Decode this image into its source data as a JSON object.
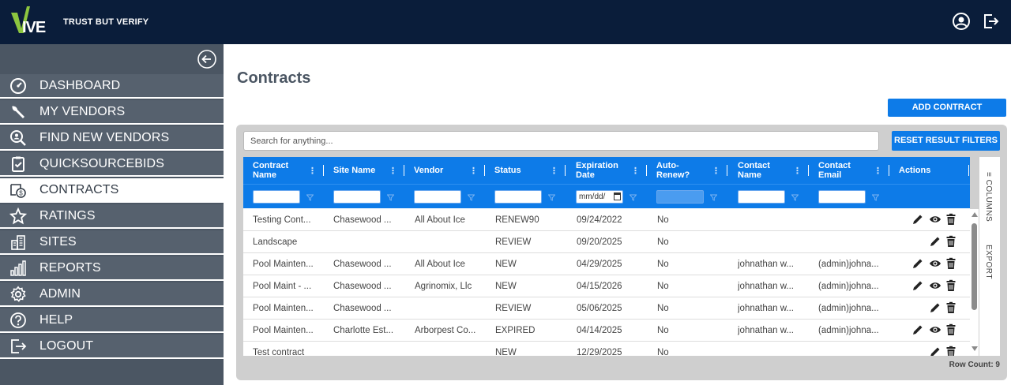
{
  "app": {
    "logo_text": "VIVE",
    "tagline": "TRUST BUT VERIFY",
    "colors": {
      "topbar": "#0a1d3a",
      "sidebar": "#4b5663",
      "accent": "#0d7be8",
      "logo_green": "#8cc63f"
    }
  },
  "header_icons": [
    {
      "name": "account-icon"
    },
    {
      "name": "logout-icon"
    }
  ],
  "sidebar": {
    "collapse_icon": "arrow-left-circle-icon",
    "items": [
      {
        "label": "DASHBOARD",
        "icon": "speedometer-icon",
        "active": false
      },
      {
        "label": "MY VENDORS",
        "icon": "wrench-icon",
        "active": false
      },
      {
        "label": "FIND NEW VENDORS",
        "icon": "search-person-icon",
        "active": false
      },
      {
        "label": "QUICKSOURCEBIDS",
        "icon": "clipboard-check-icon",
        "active": false
      },
      {
        "label": "CONTRACTS",
        "icon": "contract-money-icon",
        "active": true
      },
      {
        "label": "RATINGS",
        "icon": "star-icon",
        "active": false
      },
      {
        "label": "SITES",
        "icon": "building-icon",
        "active": false
      },
      {
        "label": "REPORTS",
        "icon": "bar-chart-icon",
        "active": false
      },
      {
        "label": "ADMIN",
        "icon": "gear-icon",
        "active": false
      },
      {
        "label": "HELP",
        "icon": "help-circle-icon",
        "active": false
      },
      {
        "label": "LOGOUT",
        "icon": "logout-icon",
        "active": false
      }
    ]
  },
  "main": {
    "title": "Contracts",
    "add_button": "ADD CONTRACT",
    "search_placeholder": "Search for anything...",
    "reset_button": "RESET RESULT FILTERS",
    "side_tabs": {
      "columns": "COLUMNS",
      "export": "EXPORT"
    },
    "row_count": "Row Count: 9",
    "date_filter_placeholder": "mm/dd/"
  },
  "table": {
    "columns": [
      {
        "label": "Contract Name",
        "filter": "text"
      },
      {
        "label": "Site Name",
        "filter": "text"
      },
      {
        "label": "Vendor",
        "filter": "text"
      },
      {
        "label": "Status",
        "filter": "text"
      },
      {
        "label": "Expiration Date",
        "filter": "date"
      },
      {
        "label": "Auto-Renew?",
        "filter": "disabled"
      },
      {
        "label": "Contact Name",
        "filter": "text"
      },
      {
        "label": "Contact Email",
        "filter": "text"
      },
      {
        "label": "Actions",
        "filter": "none"
      }
    ],
    "rows": [
      {
        "cells": [
          "Testing Cont...",
          "Chasewood ...",
          "All About Ice",
          "RENEW90",
          "09/24/2022",
          "No",
          "",
          ""
        ],
        "actions": [
          "edit",
          "view",
          "delete"
        ]
      },
      {
        "cells": [
          "Landscape",
          "",
          "",
          "REVIEW",
          "09/20/2025",
          "No",
          "",
          ""
        ],
        "actions": [
          "edit",
          "delete"
        ]
      },
      {
        "cells": [
          "Pool Mainten...",
          "Chasewood ...",
          "All About Ice",
          "NEW",
          "04/29/2025",
          "No",
          "johnathan w...",
          "(admin)johna..."
        ],
        "actions": [
          "edit",
          "view",
          "delete"
        ]
      },
      {
        "cells": [
          "Pool Maint - ...",
          "Chasewood ...",
          "Agrinomix, Llc",
          "NEW",
          "04/15/2026",
          "No",
          "johnathan w...",
          "(admin)johna..."
        ],
        "actions": [
          "edit",
          "view",
          "delete"
        ]
      },
      {
        "cells": [
          "Pool Mainten...",
          "Chasewood ...",
          "",
          "REVIEW",
          "05/06/2025",
          "No",
          "johnathan w...",
          "(admin)johna..."
        ],
        "actions": [
          "edit",
          "delete"
        ]
      },
      {
        "cells": [
          "Pool Mainten...",
          "Charlotte Est...",
          "Arborpest Co...",
          "EXPIRED",
          "04/14/2025",
          "No",
          "johnathan w...",
          "(admin)johna..."
        ],
        "actions": [
          "edit",
          "view",
          "delete"
        ]
      },
      {
        "cells": [
          "Test contract",
          "",
          "",
          "NEW",
          "12/29/2025",
          "No",
          "",
          ""
        ],
        "actions": [
          "edit",
          "delete"
        ]
      }
    ]
  }
}
